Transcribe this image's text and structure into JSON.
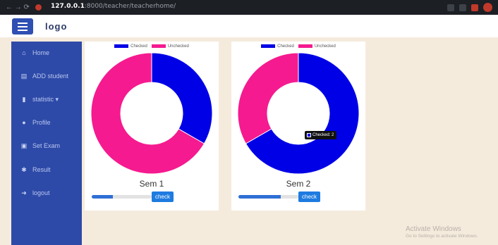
{
  "browser": {
    "url_host": "127.0.0.1",
    "url_path": ":8000/teacher/teacherhome/"
  },
  "header": {
    "logo": "logo"
  },
  "sidebar": {
    "items": [
      {
        "label": "Home",
        "icon": "home-icon",
        "glyph": "⌂"
      },
      {
        "label": "ADD student",
        "icon": "file-icon",
        "glyph": "▤"
      },
      {
        "label": "statistic ▾",
        "icon": "bar-chart-icon",
        "glyph": "▮"
      },
      {
        "label": "Profile",
        "icon": "user-icon",
        "glyph": "●"
      },
      {
        "label": "Set Exam",
        "icon": "id-card-icon",
        "glyph": "▣"
      },
      {
        "label": "Result",
        "icon": "gear-icon",
        "glyph": "✱"
      },
      {
        "label": "logout",
        "icon": "logout-icon",
        "glyph": "➜"
      }
    ]
  },
  "colors": {
    "checked": "#0000e6",
    "unchecked": "#f51a8f"
  },
  "cards": [
    {
      "legend": [
        "Checked",
        "Unchecked"
      ],
      "chart_data": {
        "type": "pie",
        "categories": [
          "Checked",
          "Unchecked"
        ],
        "values": [
          1,
          2
        ],
        "hole": true
      },
      "title": "Sem 1",
      "progress": 0.35,
      "button": "check"
    },
    {
      "legend": [
        "Checked",
        "Unchecked"
      ],
      "chart_data": {
        "type": "pie",
        "categories": [
          "Checked",
          "Unchecked"
        ],
        "values": [
          2,
          1
        ],
        "hole": true
      },
      "tooltip": "Checked: 2",
      "title": "Sem 2",
      "progress": 0.7,
      "button": "check"
    }
  ],
  "watermark": {
    "line1": "Activate Windows",
    "line2": "Go to Settings to activate Windows."
  }
}
